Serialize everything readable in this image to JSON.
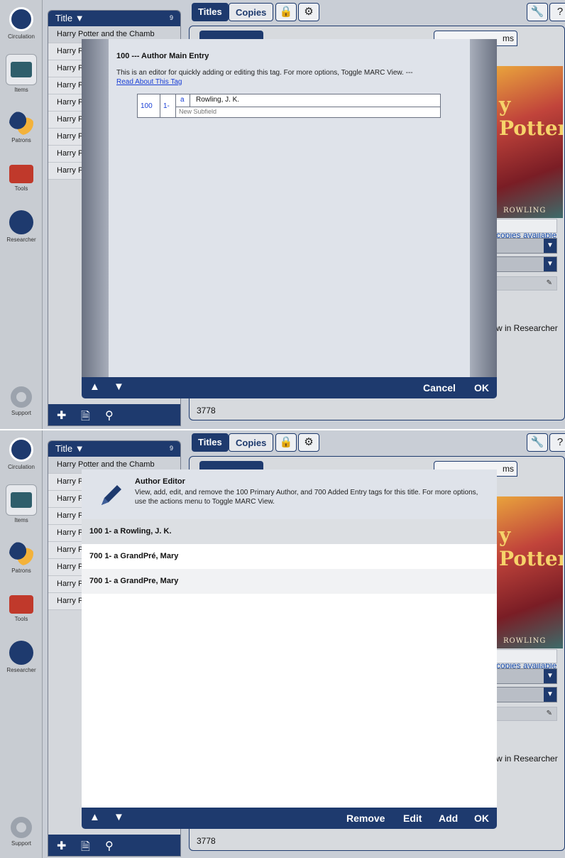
{
  "rail": {
    "items": [
      {
        "label": "Circulation"
      },
      {
        "label": "Items"
      },
      {
        "label": "Patrons"
      },
      {
        "label": "Tools"
      },
      {
        "label": "Researcher"
      },
      {
        "label": "Support"
      }
    ]
  },
  "list": {
    "header": "Title ▼",
    "count": "9",
    "rows": [
      "Harry Potter and the Chamb",
      "Harry P",
      "Harry P",
      "Harry P",
      "Harry P",
      "Harry P",
      "Harry P",
      "Harry P",
      "Harry P"
    ],
    "footer_icons": [
      "plus-icon",
      "document-icon",
      "search-icon"
    ]
  },
  "toolbar": {
    "titles_label": "Titles",
    "copies_label": "Copies",
    "icons": [
      "lock-icon",
      "gear-icon",
      "wrench-icon",
      "help-icon"
    ]
  },
  "detail": {
    "subtab_last": "ms",
    "cover_title": "y Potter",
    "cover_author": "ROWLING",
    "copies_available": "copies available",
    "view_in_researcher": "w in Researcher",
    "barcode": "3778"
  },
  "tag_editor": {
    "title": "100 --- Author Main Entry",
    "desc": "This is an editor for quickly adding or editing this tag. For more options, Toggle MARC View. ---",
    "link": "Read About This Tag",
    "tag": "100",
    "indicators": "1-",
    "subfield_code": "a",
    "subfield_value": "Rowling, J. K.",
    "new_subfield": "New Subfield",
    "cancel_label": "Cancel",
    "ok_label": "OK"
  },
  "author_editor": {
    "title": "Author Editor",
    "desc": "View, add, edit, and remove the 100 Primary Author, and 700 Added Entry tags for this title. For more options, use the actions menu to Toggle MARC View.",
    "rows": [
      "100 1-   a  Rowling, J. K.",
      "700 1-   a  GrandPré, Mary",
      "700 1-   a  GrandPre, Mary"
    ],
    "remove_label": "Remove",
    "edit_label": "Edit",
    "add_label": "Add",
    "ok_label": "OK"
  },
  "colors": {
    "navy": "#1e3a6e",
    "link": "#1a3fd6"
  }
}
